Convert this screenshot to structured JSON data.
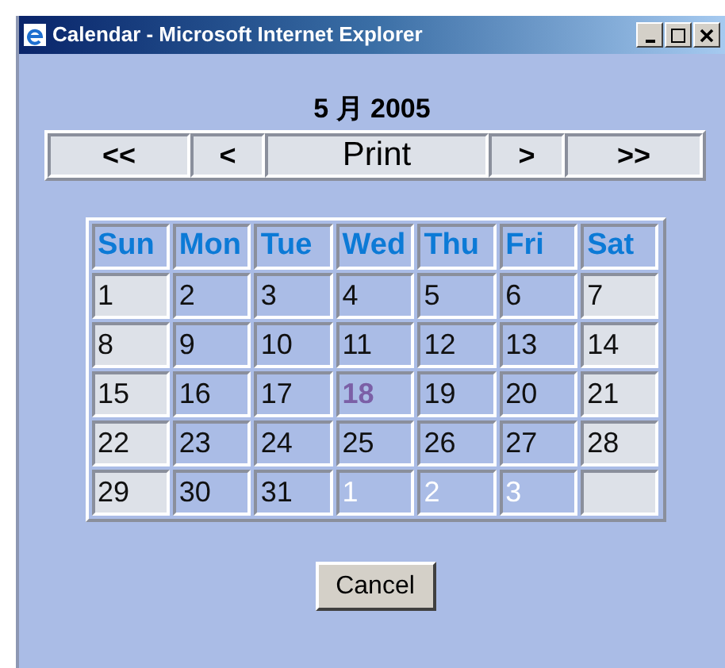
{
  "window": {
    "title": "Calendar - Microsoft Internet Explorer"
  },
  "heading": "5 月 2005",
  "nav": [
    "<<",
    "<",
    "Print",
    ">",
    ">>"
  ],
  "weekdays": [
    "Sun",
    "Mon",
    "Tue",
    "Wed",
    "Thu",
    "Fri",
    "Sat"
  ],
  "days": [
    {
      "label": "1",
      "other_month": false,
      "selected": false
    },
    {
      "label": "2",
      "other_month": false,
      "selected": false
    },
    {
      "label": "3",
      "other_month": false,
      "selected": false
    },
    {
      "label": "4",
      "other_month": false,
      "selected": false
    },
    {
      "label": "5",
      "other_month": false,
      "selected": false
    },
    {
      "label": "6",
      "other_month": false,
      "selected": false
    },
    {
      "label": "7",
      "other_month": false,
      "selected": false
    },
    {
      "label": "8",
      "other_month": false,
      "selected": false
    },
    {
      "label": "9",
      "other_month": false,
      "selected": false
    },
    {
      "label": "10",
      "other_month": false,
      "selected": false
    },
    {
      "label": "11",
      "other_month": false,
      "selected": false
    },
    {
      "label": "12",
      "other_month": false,
      "selected": false
    },
    {
      "label": "13",
      "other_month": false,
      "selected": false
    },
    {
      "label": "14",
      "other_month": false,
      "selected": false
    },
    {
      "label": "15",
      "other_month": false,
      "selected": false
    },
    {
      "label": "16",
      "other_month": false,
      "selected": false
    },
    {
      "label": "17",
      "other_month": false,
      "selected": false
    },
    {
      "label": "18",
      "other_month": false,
      "selected": true
    },
    {
      "label": "19",
      "other_month": false,
      "selected": false
    },
    {
      "label": "20",
      "other_month": false,
      "selected": false
    },
    {
      "label": "21",
      "other_month": false,
      "selected": false
    },
    {
      "label": "22",
      "other_month": false,
      "selected": false
    },
    {
      "label": "23",
      "other_month": false,
      "selected": false
    },
    {
      "label": "24",
      "other_month": false,
      "selected": false
    },
    {
      "label": "25",
      "other_month": false,
      "selected": false
    },
    {
      "label": "26",
      "other_month": false,
      "selected": false
    },
    {
      "label": "27",
      "other_month": false,
      "selected": false
    },
    {
      "label": "28",
      "other_month": false,
      "selected": false
    },
    {
      "label": "29",
      "other_month": false,
      "selected": false
    },
    {
      "label": "30",
      "other_month": false,
      "selected": false
    },
    {
      "label": "31",
      "other_month": false,
      "selected": false
    },
    {
      "label": "1",
      "other_month": true,
      "selected": false
    },
    {
      "label": "2",
      "other_month": true,
      "selected": false
    },
    {
      "label": "3",
      "other_month": true,
      "selected": false
    }
  ],
  "cancel_button": "Cancel"
}
